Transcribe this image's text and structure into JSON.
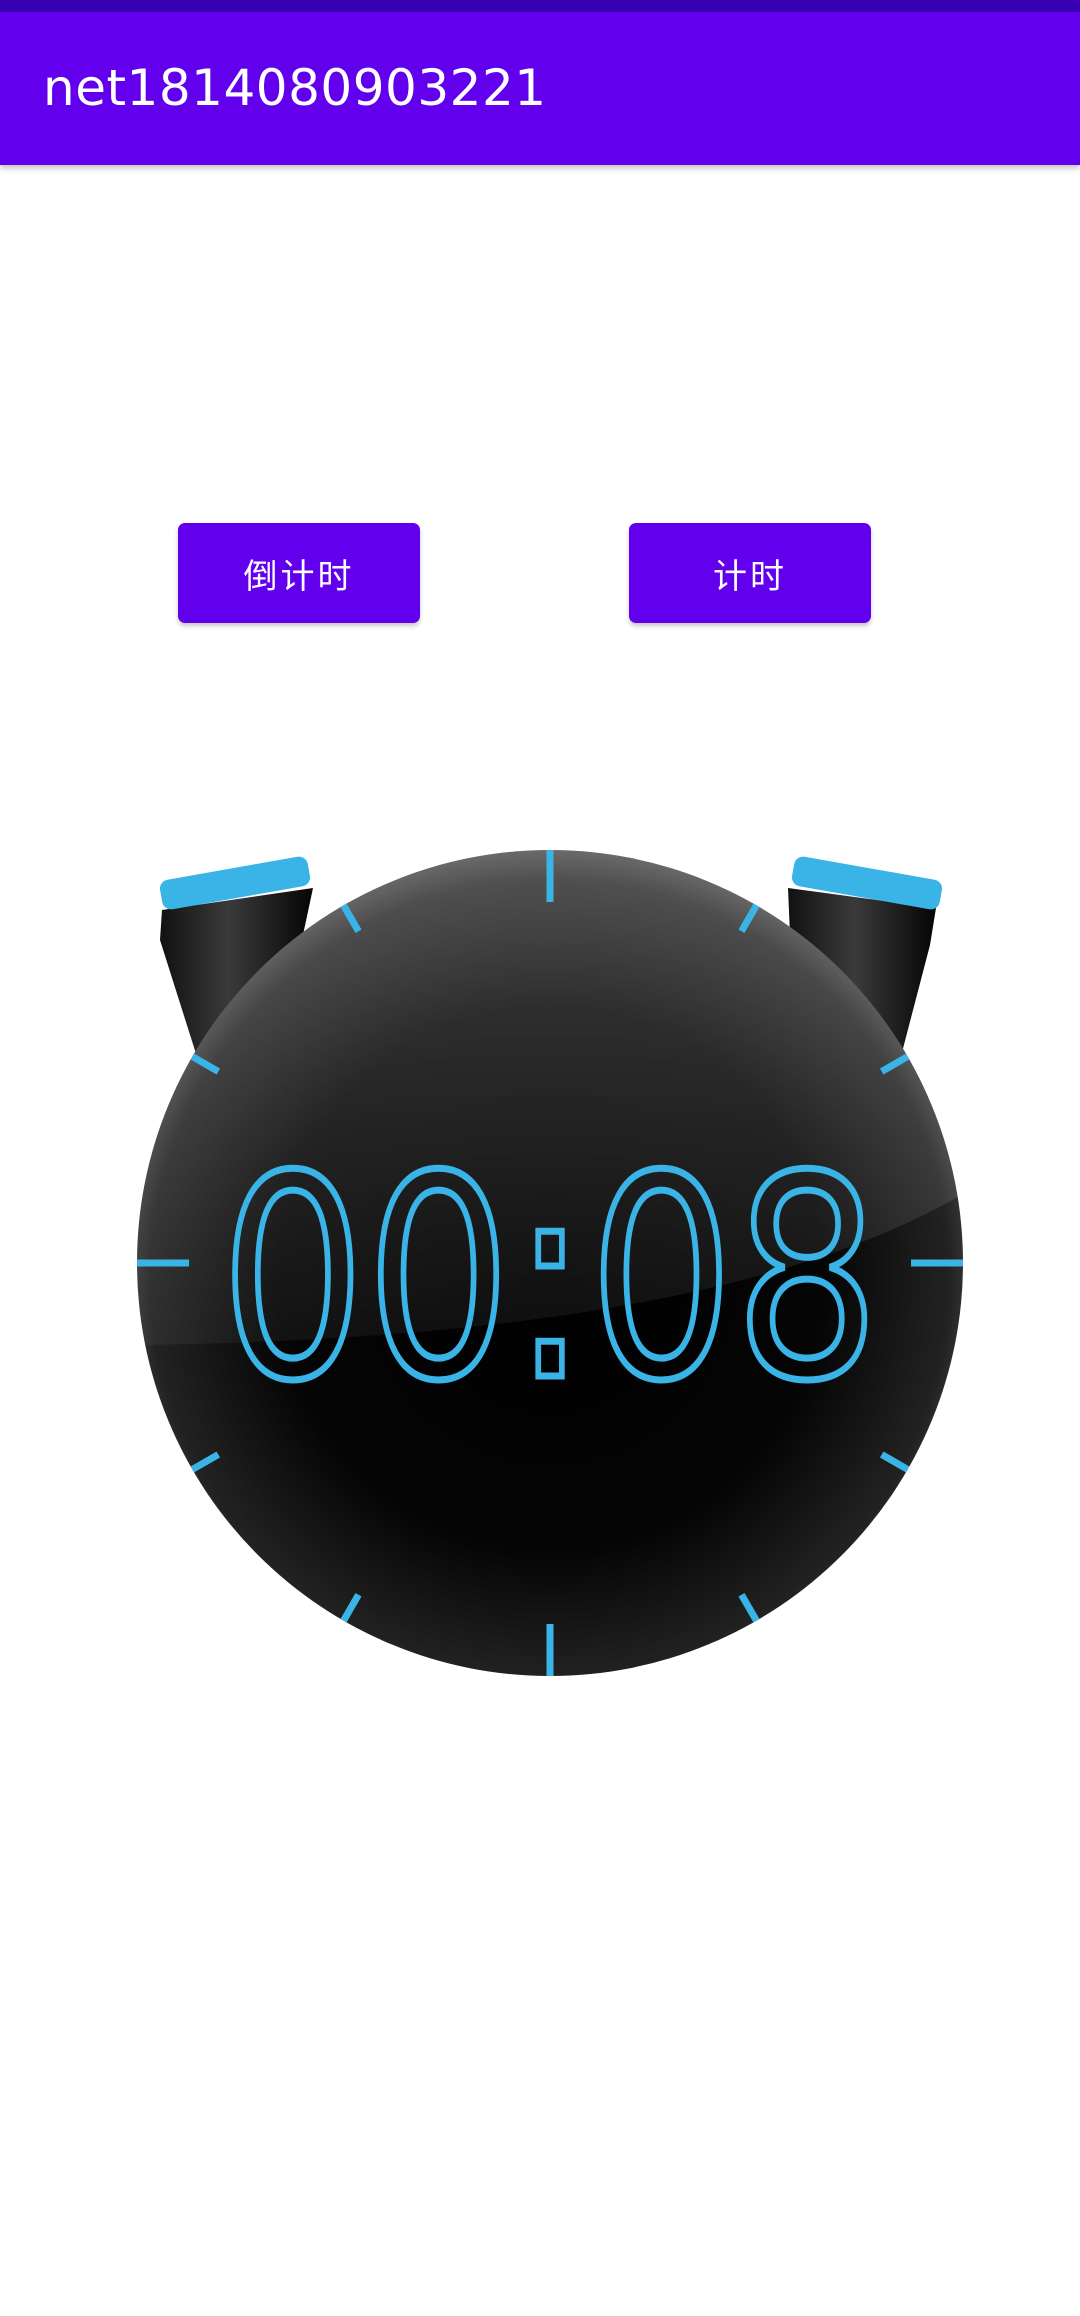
{
  "app": {
    "title": "net1814080903221"
  },
  "buttons": {
    "countdown_label": "倒计时",
    "timer_label": "计时"
  },
  "stopwatch": {
    "time": "00:08"
  },
  "colors": {
    "status_bar": "#3700b3",
    "app_bar": "#6200ee",
    "button": "#6200ee",
    "accent": "#3ab4e6",
    "face": "#0a0a0a"
  }
}
